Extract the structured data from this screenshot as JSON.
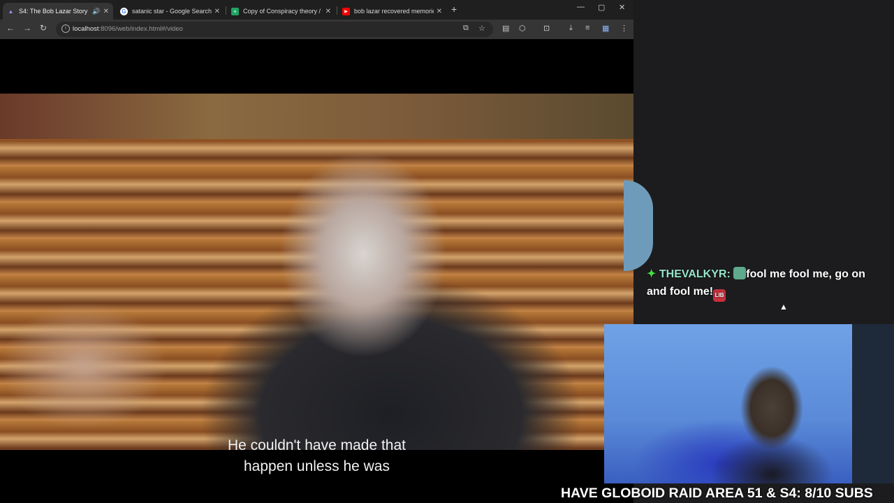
{
  "browser": {
    "tabs": [
      {
        "title": "S4: The Bob Lazar Story",
        "favicon": "triangle-logo-icon",
        "active": true,
        "audio": true
      },
      {
        "title": "satanic star - Google Search",
        "favicon": "google-icon",
        "active": false
      },
      {
        "title": "Copy of Conspiracy theory / tre",
        "favicon": "sheets-icon",
        "active": false
      },
      {
        "title": "bob lazar recovered memories",
        "favicon": "youtube-icon",
        "active": false
      }
    ],
    "url_host": "localhost",
    "url_rest": ":8096/web/index.html#/video"
  },
  "video": {
    "subtitle_line1": "He couldn't have made that",
    "subtitle_line2": "happen unless he was"
  },
  "chat": {
    "username": "THEVALKYR:",
    "message": "fool me fool me, go on and fool me!",
    "emote_badge_text": "LIB"
  },
  "overlay": {
    "banner": "HAVE GLOBOID RAID AREA 51 & S4: 8/10 SUBS"
  },
  "colors": {
    "tab_strip": "#1f1f1f",
    "toolbar": "#353535",
    "username": "#97e4c8",
    "star": "#44dd44"
  }
}
